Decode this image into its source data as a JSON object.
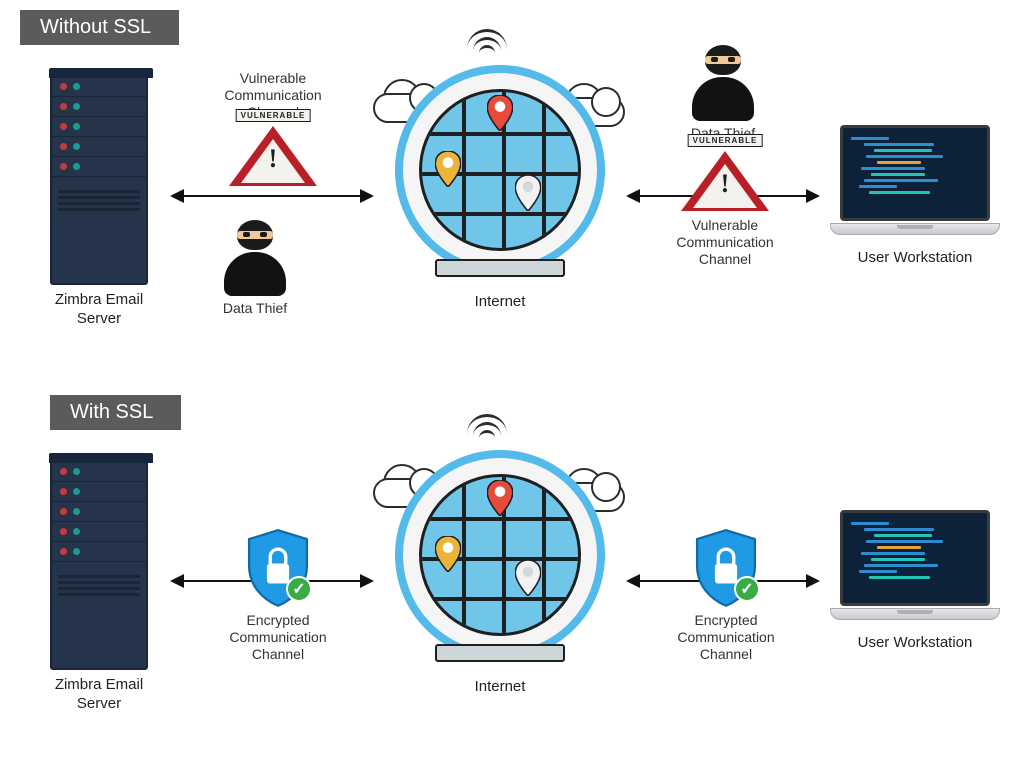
{
  "titles": {
    "without": "Without SSL",
    "with": "With SSL"
  },
  "labels": {
    "server": "Zimbra Email\nServer",
    "internet": "Internet",
    "workstation": "User Workstation",
    "thief": "Data Thief",
    "vulnerable_channel": "Vulnerable\nCommunication\nChannel",
    "encrypted_channel": "Encrypted\nCommunication\nChannel",
    "vulnerable_badge": "VULNERABLE"
  },
  "icons": {
    "server": "server-rack-icon",
    "globe": "globe-internet-icon",
    "laptop": "laptop-code-icon",
    "thief": "data-thief-icon",
    "warning": "warning-triangle-icon",
    "shield": "shield-lock-icon",
    "check": "check-badge-icon",
    "wifi": "wifi-icon",
    "cloud": "cloud-icon",
    "pin": "map-pin-icon"
  },
  "colors": {
    "title_bg": "#5a5b5d",
    "server_bg": "#25344a",
    "globe_ring": "#54baea",
    "globe_fill": "#6fc6e8",
    "warning_red": "#b81f27",
    "shield_blue": "#1e9be4",
    "check_green": "#3bab47",
    "pin_red": "#e64b3c",
    "pin_yellow": "#ecb53a",
    "pin_white": "#f2f2f2"
  }
}
